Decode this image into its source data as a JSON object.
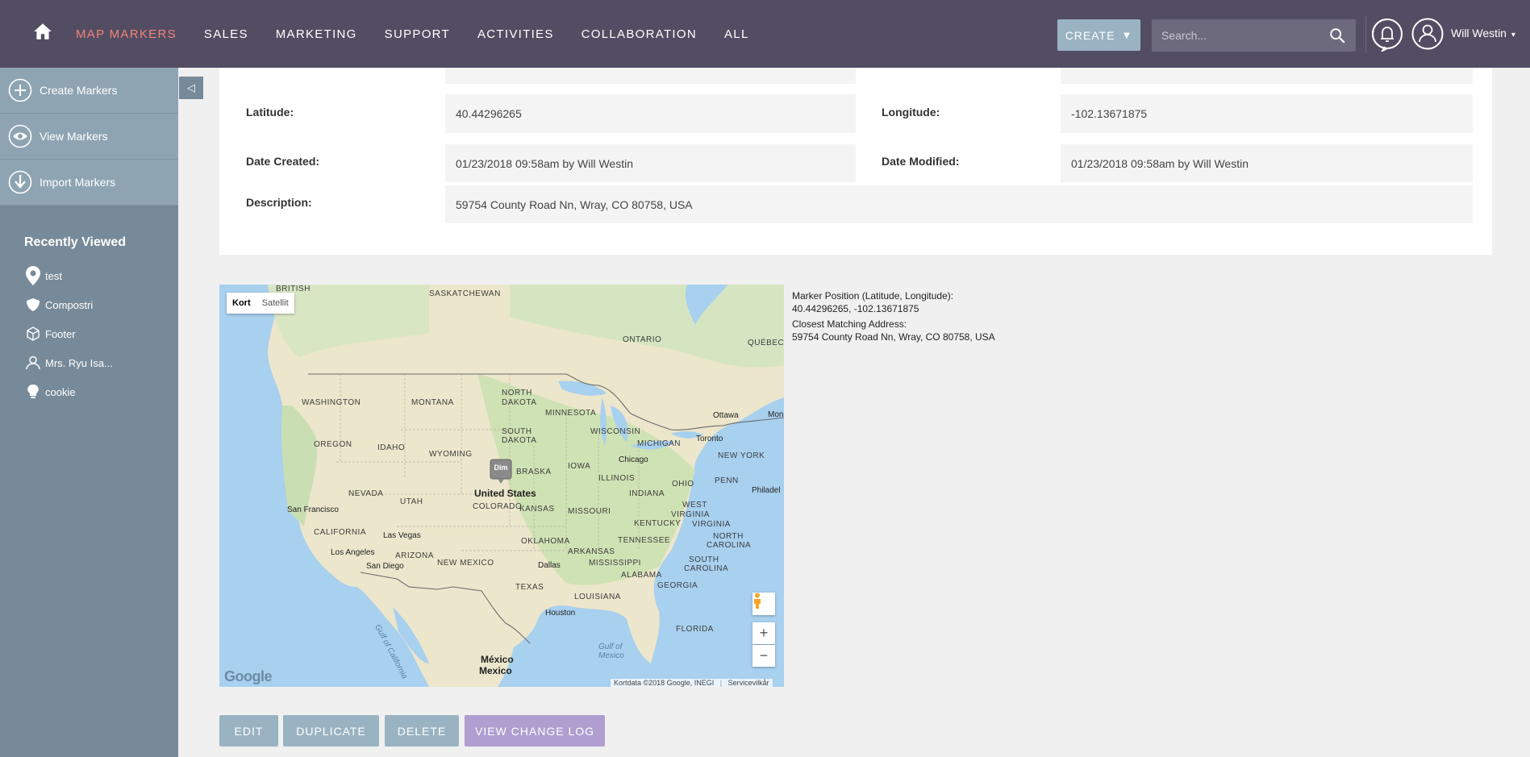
{
  "nav": {
    "items": [
      {
        "label": "MAP MARKERS",
        "active": true
      },
      {
        "label": "SALES"
      },
      {
        "label": "MARKETING"
      },
      {
        "label": "SUPPORT"
      },
      {
        "label": "ACTIVITIES"
      },
      {
        "label": "COLLABORATION"
      },
      {
        "label": "ALL"
      }
    ],
    "create_label": "CREATE",
    "search_placeholder": "Search...",
    "user_name": "Will Westin"
  },
  "sidebar": {
    "actions": [
      {
        "label": "Create Markers",
        "icon": "plus-circle-icon"
      },
      {
        "label": "View Markers",
        "icon": "eye-icon"
      },
      {
        "label": "Import Markers",
        "icon": "download-icon"
      }
    ],
    "recent_title": "Recently Viewed",
    "recent": [
      {
        "label": "test",
        "icon": "map-pin-icon"
      },
      {
        "label": "Compostri",
        "icon": "shield-icon"
      },
      {
        "label": "Footer",
        "icon": "cube-icon"
      },
      {
        "label": "Mrs. Ryu Isa...",
        "icon": "person-icon"
      },
      {
        "label": "cookie",
        "icon": "lightbulb-icon"
      }
    ]
  },
  "detail": {
    "latitude_label": "Latitude:",
    "latitude": "40.44296265",
    "longitude_label": "Longitude:",
    "longitude": "-102.13671875",
    "date_created_label": "Date Created:",
    "date_created": "01/23/2018 09:58am by Will Westin",
    "date_modified_label": "Date Modified:",
    "date_modified": "01/23/2018 09:58am by Will Westin",
    "description_label": "Description:",
    "description": "59754 County Road Nn, Wray, CO 80758, USA"
  },
  "map": {
    "type_map": "Kort",
    "type_satellite": "Satellit",
    "marker_label": "Dim",
    "google": "Google",
    "footer_data": "Kortdata ©2018 Google, INEGI",
    "footer_terms": "Servicevilkår",
    "labels": {
      "british": "BRITISH",
      "saskatchewan": "SASKATCHEWAN",
      "ontario": "ONTARIO",
      "quebec": "QUÉBEC",
      "washington": "WASHINGTON",
      "montana": "MONTANA",
      "north_dakota_1": "NORTH",
      "north_dakota_2": "DAKOTA",
      "minnesota": "MINNESOTA",
      "ottawa": "Ottawa",
      "montreal": "Mon",
      "oregon": "OREGON",
      "idaho": "IDAHO",
      "south_dakota_1": "SOUTH",
      "south_dakota_2": "DAKOTA",
      "wisconsin": "WISCONSIN",
      "michigan": "MICHIGAN",
      "toronto": "Toronto",
      "wyoming": "WYOMING",
      "new_york": "NEW YORK",
      "chicago": "Chicago",
      "iowa": "IOWA",
      "nebraska": "BRASKA",
      "nevada": "NEVADA",
      "utah": "UTAH",
      "united_states": "United States",
      "illinois": "ILLINOIS",
      "ohio": "OHIO",
      "penn": "PENN",
      "philadelphia": "Philadel",
      "indiana": "INDIANA",
      "san_francisco": "San Francisco",
      "colorado": "COLORADO",
      "kansas": "KANSAS",
      "missouri": "MISSOURI",
      "west_1": "WEST",
      "west_2": "VIRGINIA",
      "california": "CALIFORNIA",
      "las_vegas": "Las Vegas",
      "kentucky": "KENTUCKY",
      "virginia": "VIRGINIA",
      "oklahoma": "OKLAHOMA",
      "tennessee": "TENNESSEE",
      "north_carolina_1": "NORTH",
      "north_carolina_2": "CAROLINA",
      "los_angeles": "Los Angeles",
      "arizona": "ARIZONA",
      "arkansas": "ARKANSAS",
      "san_diego": "San Diego",
      "new_mexico": "NEW MEXICO",
      "dallas": "Dallas",
      "mississippi": "MISSISSIPPI",
      "south_carolina_1": "SOUTH",
      "south_carolina_2": "CAROLINA",
      "alabama": "ALABAMA",
      "georgia": "GEORGIA",
      "texas": "TEXAS",
      "louisiana": "LOUISIANA",
      "houston": "Houston",
      "florida": "FLORIDA",
      "gulf_california": "Gulf of California",
      "gulf_mexico_1": "Gulf of",
      "gulf_mexico_2": "Mexico",
      "mexico_1": "México",
      "mexico_2": "Mexico"
    }
  },
  "info": {
    "position_label": "Marker Position (Latitude, Longitude):",
    "position_value": "40.44296265, -102.13671875",
    "address_label": "Closest Matching Address:",
    "address_value": "59754 County Road Nn, Wray, CO 80758, USA"
  },
  "buttons": {
    "edit": "EDIT",
    "duplicate": "DUPLICATE",
    "delete": "DELETE",
    "change_log": "VIEW CHANGE LOG"
  },
  "colors": {
    "topbar": "#534d64",
    "accent": "#f08377",
    "sidebar": "#778a99",
    "button": "#9ab3c2",
    "change_log_button": "#b09ed0"
  }
}
